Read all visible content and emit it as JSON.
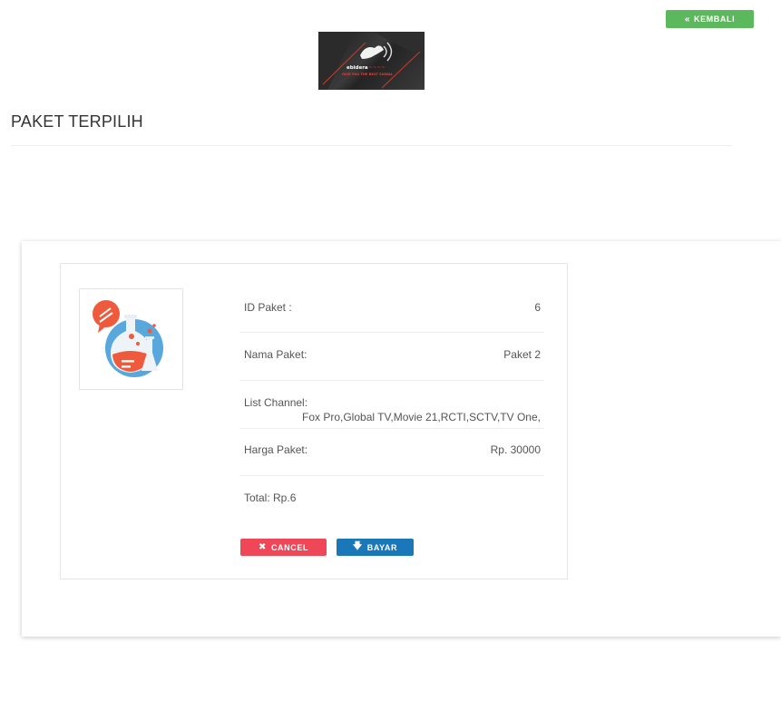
{
  "header": {
    "back_label": "KEMBALI",
    "back_icon": "double-chevron-left-icon",
    "logo_text": "ebidera",
    "logo_tagline": "GIVE YOU THE BEST SIGNAL"
  },
  "page": {
    "title": "PAKET TERPILIH"
  },
  "package": {
    "image_icon": "flask-chemistry-icon",
    "id_label": "ID Paket :",
    "id_value": "6",
    "name_label": "Nama Paket:",
    "name_value": "Paket 2",
    "channels_label": "List Channel:",
    "channels_value": "Fox Pro,Global TV,Movie 21,RCTI,SCTV,TV One,",
    "price_label": "Harga Paket:",
    "price_value": "Rp. 30000",
    "total_text": "Total: Rp.6"
  },
  "actions": {
    "cancel_label": "CANCEL",
    "cancel_icon": "x-icon",
    "bayar_label": "BAYAR",
    "bayar_icon": "arrow-down-icon"
  },
  "colors": {
    "back_button": "#5cb85c",
    "cancel_button": "#ef4758",
    "bayar_button": "#1a78b8"
  }
}
